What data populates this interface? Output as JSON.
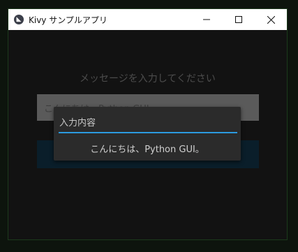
{
  "window": {
    "title": "Kivy サンプルアプリ",
    "app_icon": "kivy-logo",
    "controls": {
      "minimize_icon": "minimize-icon",
      "maximize_icon": "maximize-icon",
      "close_icon": "close-icon"
    }
  },
  "main": {
    "prompt": "メッセージを入力してください",
    "input_value": "こんにちは、Python GUI。",
    "button_label": ""
  },
  "popup": {
    "field_value": "入力内容",
    "message": "こんにちは、Python GUI。"
  },
  "colors": {
    "accent_underline": "#2c9be0",
    "button_bg": "#0a1e2a",
    "input_bg": "#5a5a5a"
  }
}
